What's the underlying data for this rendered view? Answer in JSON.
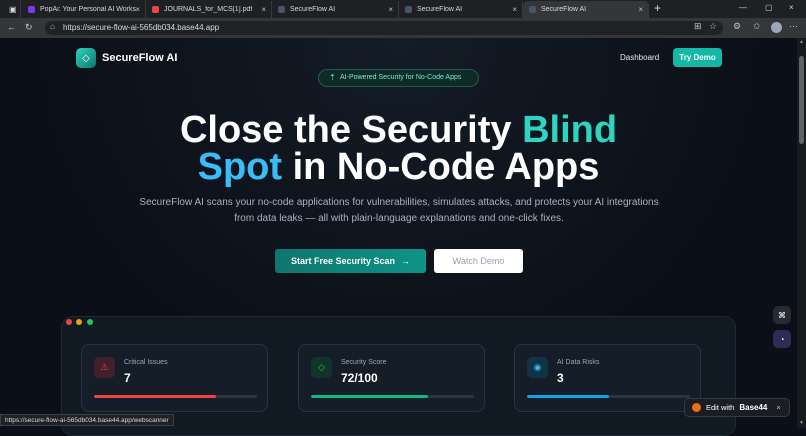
{
  "browser": {
    "tabs": [
      {
        "label": "PopAi: Your Personal AI Workspace",
        "fav": "#7c3aed"
      },
      {
        "label": "JOURNALS_for_MCS[1].pdf",
        "fav": "#ef4444"
      },
      {
        "label": "SecureFlow AI",
        "fav": "#475569"
      },
      {
        "label": "SecureFlow AI",
        "fav": "#475569"
      },
      {
        "label": "SecureFlow AI",
        "fav": "#475569"
      }
    ],
    "url": "https://secure-flow-ai-565db034.base44.app",
    "status_url": "https://secure-flow-ai-565db034.base44.app/webscanner"
  },
  "nav": {
    "brand": "SecureFlow AI",
    "dashboard": "Dashboard",
    "cta": "Try Demo"
  },
  "badge": "AI-Powered Security for No-Code Apps",
  "hero": {
    "l1_a": "Close the Security ",
    "l1_b": "Blind",
    "l2_a": "Spot",
    "l2_b": " in No-Code Apps"
  },
  "subtitle": "SecureFlow AI scans your no-code applications for vulnerabilities, simulates attacks, and protects your AI integrations from data leaks — all with plain-language explanations and one-click fixes.",
  "buttons": {
    "primary": "Start Free Security Scan",
    "secondary": "Watch Demo"
  },
  "cards": [
    {
      "label": "Critical Issues",
      "value": "7",
      "color": "#ef4444",
      "fill": 0.75
    },
    {
      "label": "Security Score",
      "value": "72/100",
      "color": "#10b981",
      "fill": 0.72
    },
    {
      "label": "AI Data Risks",
      "value": "3",
      "color": "#0ea5e9",
      "fill": 0.5
    }
  ],
  "float": {
    "grid": "⌘",
    "chat": "◔"
  },
  "base44": {
    "prefix": "Edit with",
    "name": "Base44"
  }
}
